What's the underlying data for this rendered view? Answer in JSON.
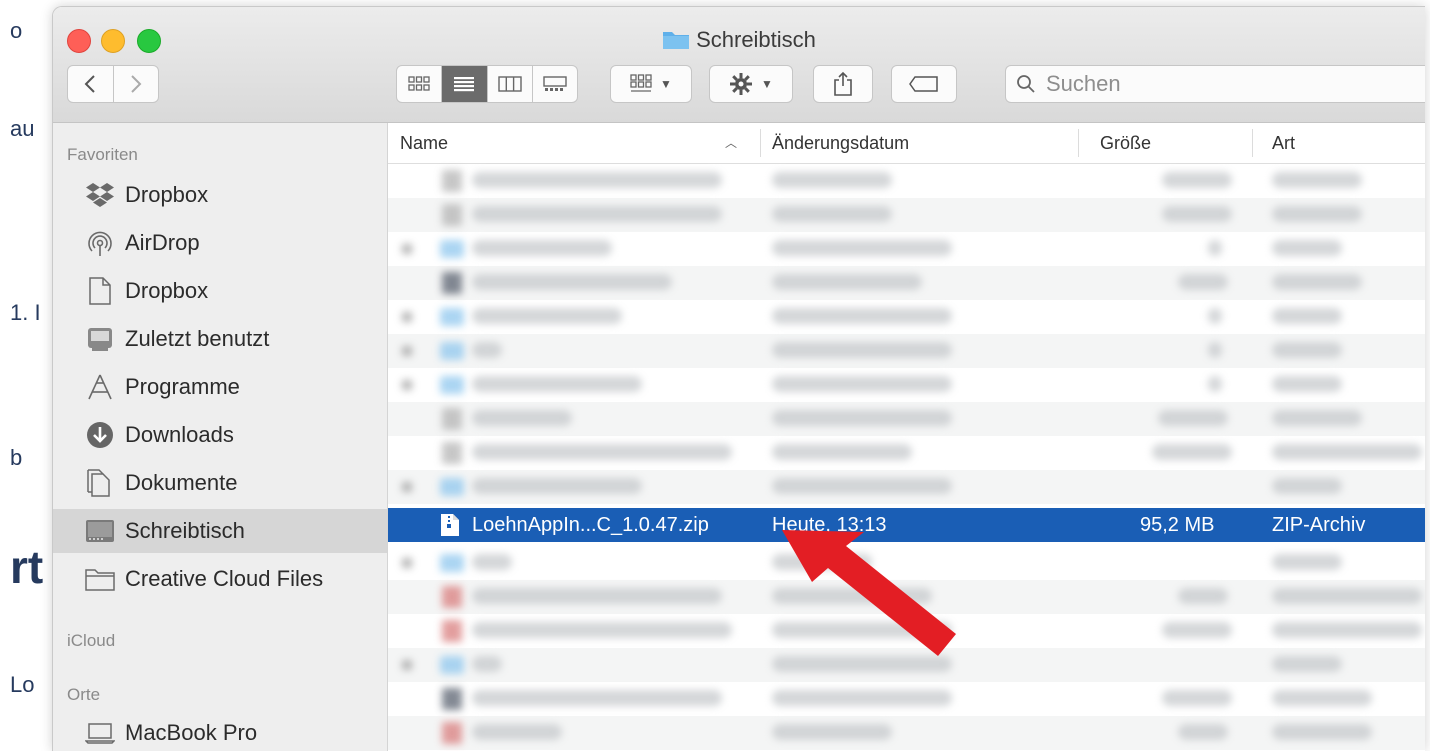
{
  "background_fragments": [
    "o",
    "au",
    "1. I",
    "b",
    "rt",
    "Lo"
  ],
  "window": {
    "title": "Schreibtisch"
  },
  "toolbar": {
    "back_icon": "chevron-left-icon",
    "forward_icon": "chevron-right-icon",
    "view_modes": [
      "icon-view",
      "list-view",
      "column-view",
      "gallery-view"
    ],
    "active_view": "list-view",
    "search_placeholder": "Suchen"
  },
  "sidebar": {
    "sections": [
      {
        "heading": "Favoriten",
        "items": [
          {
            "label": "Dropbox",
            "icon": "dropbox-icon"
          },
          {
            "label": "AirDrop",
            "icon": "airdrop-icon"
          },
          {
            "label": "Dropbox",
            "icon": "document-icon"
          },
          {
            "label": "Zuletzt benutzt",
            "icon": "recents-icon"
          },
          {
            "label": "Programme",
            "icon": "applications-icon"
          },
          {
            "label": "Downloads",
            "icon": "downloads-icon"
          },
          {
            "label": "Dokumente",
            "icon": "documents-icon"
          },
          {
            "label": "Schreibtisch",
            "icon": "desktop-icon",
            "selected": true
          },
          {
            "label": "Creative Cloud Files",
            "icon": "folder-icon"
          }
        ]
      },
      {
        "heading": "iCloud",
        "items": []
      },
      {
        "heading": "Orte",
        "items": [
          {
            "label": "MacBook Pro",
            "icon": "laptop-icon"
          }
        ]
      }
    ]
  },
  "columns": {
    "name": "Name",
    "date": "Änderungsdatum",
    "size": "Größe",
    "kind": "Art"
  },
  "selected_file": {
    "name": "LoehnAppIn...C_1.0.47.zip",
    "date": "Heute, 13:13",
    "size": "95,2 MB",
    "kind": "ZIP-Archiv",
    "icon": "zip-file-icon"
  },
  "colors": {
    "selection": "#1a5eb5",
    "arrow": "#e31e24",
    "folder": "#5fb0ea"
  }
}
